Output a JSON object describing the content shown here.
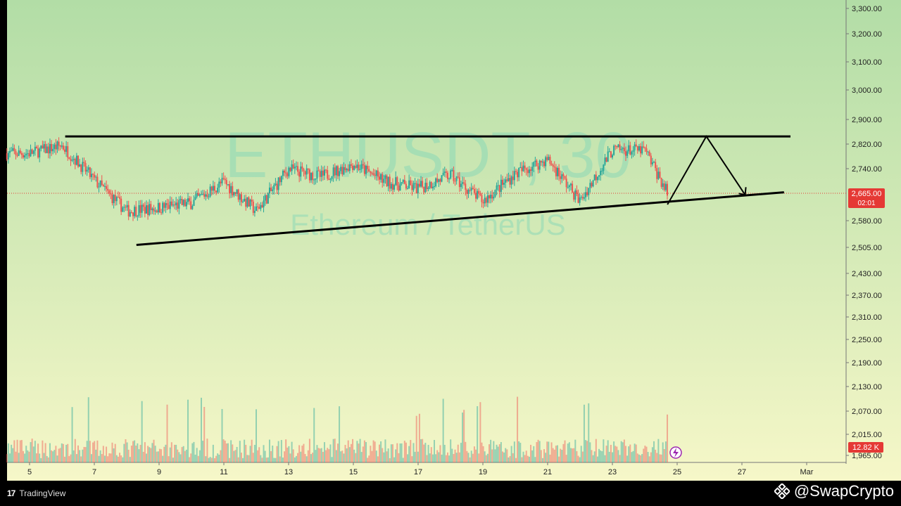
{
  "watermark": {
    "symbol": "ETHUSDT, 30",
    "description": "Ethereum / TetherUS"
  },
  "price_axis": {
    "ticks": [
      "3,300.00",
      "3,200.00",
      "3,100.00",
      "3,000.00",
      "2,900.00",
      "2,820.00",
      "2,740.00",
      "2,580.00",
      "2,505.00",
      "2,430.00",
      "2,370.00",
      "2,310.00",
      "2,250.00",
      "2,190.00",
      "2,130.00",
      "2,070.00",
      "2,015.00",
      "1,965.00"
    ],
    "last_price_label": "2,665.00",
    "countdown_label": "02:01",
    "volume_label": "12.82 K"
  },
  "time_axis": {
    "ticks": [
      "5",
      "7",
      "9",
      "11",
      "13",
      "15",
      "17",
      "19",
      "21",
      "23",
      "25",
      "27",
      "Mar"
    ]
  },
  "footer": {
    "brand": "TradingView",
    "handle": "@SwapCrypto"
  },
  "colors": {
    "up": "#26a69a",
    "down": "#ef5350",
    "last_price": "#e53935",
    "trendline": "#000000",
    "bg_top": "#b2dda6",
    "bg_bottom": "#f6f7c8"
  },
  "chart_data": {
    "type": "candlestick",
    "symbol": "ETHUSDT",
    "timeframe": "30",
    "x": [
      "5",
      "6",
      "7",
      "8",
      "9",
      "10",
      "11",
      "12",
      "13",
      "14",
      "15",
      "16",
      "17",
      "18",
      "19",
      "20",
      "21",
      "22",
      "23",
      "24",
      "24.7"
    ],
    "close": [
      2790,
      2815,
      2705,
      2610,
      2620,
      2635,
      2700,
      2610,
      2740,
      2715,
      2755,
      2700,
      2680,
      2720,
      2640,
      2725,
      2770,
      2640,
      2800,
      2800,
      2665
    ],
    "ylim": [
      1940,
      3340
    ],
    "last_price": 2665.0,
    "annotations": [
      {
        "type": "resistance_line",
        "price": 2845
      },
      {
        "type": "ascending_support_line",
        "from": {
          "x": "8.3",
          "price": 2512
        },
        "to": {
          "x": "28.3",
          "price": 2668
        }
      },
      {
        "type": "projection_path",
        "points": [
          {
            "x": "24.7",
            "price": 2630
          },
          {
            "x": "25.9",
            "price": 2845
          },
          {
            "x": "27.1",
            "price": 2660
          }
        ]
      }
    ]
  }
}
